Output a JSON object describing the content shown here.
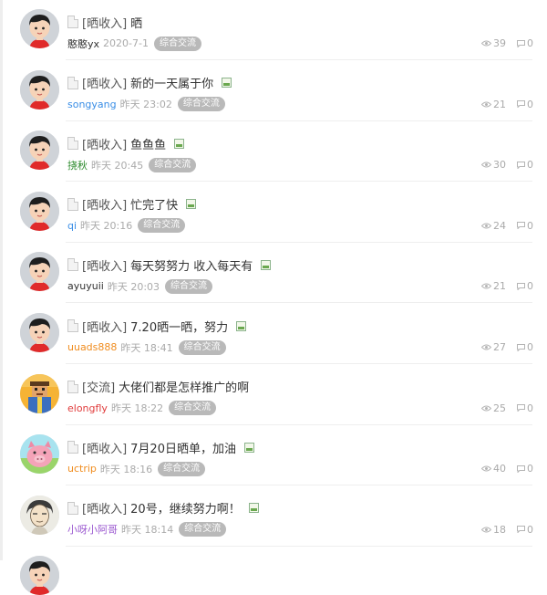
{
  "threads": [
    {
      "category": "[晒收入]",
      "title": "晒",
      "has_image": false,
      "author": "憨憨yx",
      "author_color": "#333333",
      "time": "2020-7-1",
      "forum": "综合交流",
      "views": "39",
      "replies": "0",
      "avatar": "cartoon-boy"
    },
    {
      "category": "[晒收入]",
      "title": "新的一天属于你",
      "has_image": true,
      "author": "songyang",
      "author_color": "#3a8ee6",
      "time": "昨天 23:02",
      "forum": "综合交流",
      "views": "21",
      "replies": "0",
      "avatar": "cartoon-boy"
    },
    {
      "category": "[晒收入]",
      "title": "鱼鱼鱼",
      "has_image": true,
      "author": "挠秋",
      "author_color": "#2e8b2e",
      "time": "昨天 20:45",
      "forum": "综合交流",
      "views": "30",
      "replies": "0",
      "avatar": "cartoon-boy"
    },
    {
      "category": "[晒收入]",
      "title": "忙完了快",
      "has_image": true,
      "author": "qi",
      "author_color": "#3a8ee6",
      "time": "昨天 20:16",
      "forum": "综合交流",
      "views": "24",
      "replies": "0",
      "avatar": "cartoon-boy"
    },
    {
      "category": "[晒收入]",
      "title": "每天努努力 收入每天有",
      "has_image": true,
      "author": "ayuyuii",
      "author_color": "#333333",
      "time": "昨天 20:03",
      "forum": "综合交流",
      "views": "21",
      "replies": "0",
      "avatar": "cartoon-boy"
    },
    {
      "category": "[晒收入]",
      "title": "7.20晒一晒，努力",
      "has_image": true,
      "author": "uuads888",
      "author_color": "#f08c1e",
      "time": "昨天 18:41",
      "forum": "综合交流",
      "views": "27",
      "replies": "0",
      "avatar": "cartoon-boy"
    },
    {
      "category": "[交流]",
      "title": "大佬们都是怎样推广的啊",
      "has_image": false,
      "author": "elongfly",
      "author_color": "#e03c3c",
      "time": "昨天 18:22",
      "forum": "综合交流",
      "views": "25",
      "replies": "0",
      "avatar": "pixel-character"
    },
    {
      "category": "[晒收入]",
      "title": "7月20日晒单，加油",
      "has_image": true,
      "author": "uctrip",
      "author_color": "#f08c1e",
      "time": "昨天 18:16",
      "forum": "综合交流",
      "views": "40",
      "replies": "0",
      "avatar": "pink-pig"
    },
    {
      "category": "[晒收入]",
      "title": "20号，继续努力啊！",
      "has_image": true,
      "author": "小呀小阿哥",
      "author_color": "#9b59d0",
      "time": "昨天 18:14",
      "forum": "综合交流",
      "views": "18",
      "replies": "0",
      "avatar": "sketch-face"
    }
  ],
  "colors": {
    "tag_bg": "#b9b9b9",
    "muted": "#aaaaaa",
    "separator": "#eeeeee"
  }
}
